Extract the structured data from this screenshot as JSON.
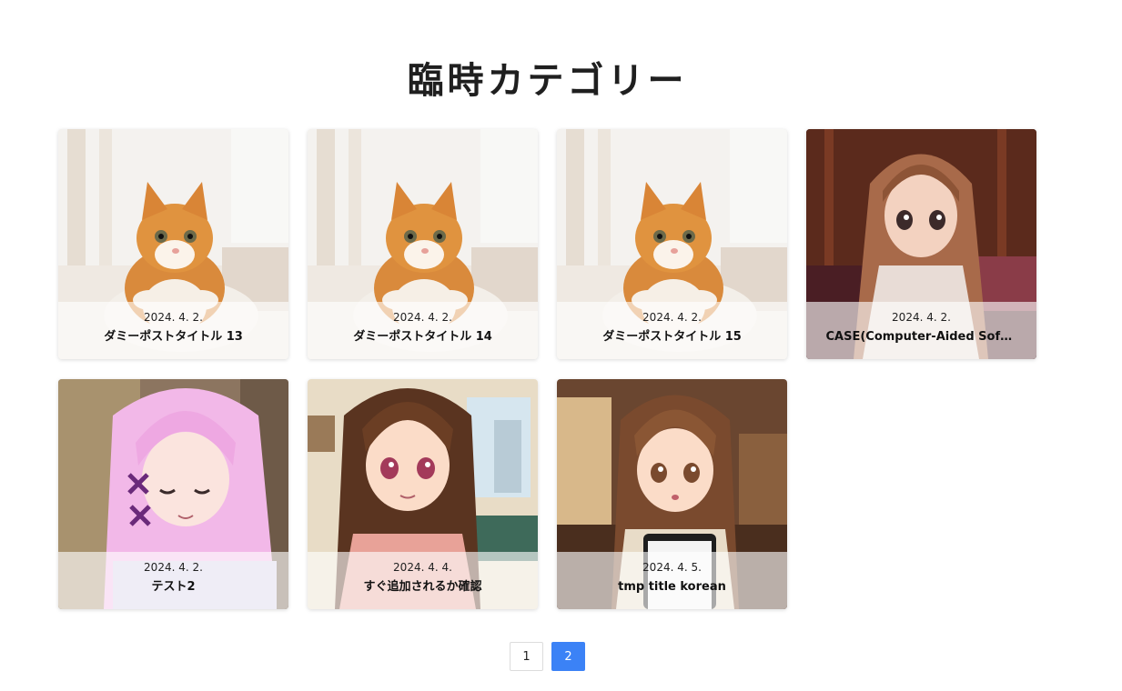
{
  "page": {
    "title": "臨時カテゴリー"
  },
  "posts": [
    {
      "date": "2024. 4. 2.",
      "title": "ダミーポストタイトル 13",
      "image": "kitten-photo"
    },
    {
      "date": "2024. 4. 2.",
      "title": "ダミーポストタイトル 14",
      "image": "kitten-photo"
    },
    {
      "date": "2024. 4. 2.",
      "title": "ダミーポストタイトル 15",
      "image": "kitten-photo"
    },
    {
      "date": "2024. 4. 2.",
      "title": "CASE(Computer-Aided Soft...",
      "image": "anime-girl-long-hair"
    },
    {
      "date": "2024. 4. 2.",
      "title": "テスト2",
      "image": "anime-girl-pink-hair"
    },
    {
      "date": "2024. 4. 4.",
      "title": "すぐ追加されるか確認",
      "image": "anime-girl-living-room"
    },
    {
      "date": "2024. 4. 5.",
      "title": "tmp title korean",
      "image": "anime-girl-phone"
    }
  ],
  "pagination": {
    "pages": [
      "1",
      "2"
    ],
    "current": "2"
  },
  "colors": {
    "accent": "#3b82f6"
  }
}
